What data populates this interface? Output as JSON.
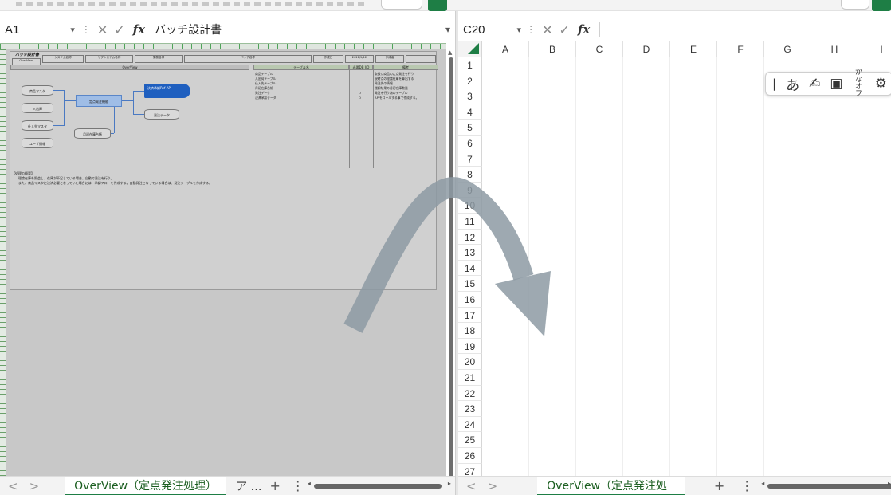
{
  "left": {
    "namebox": "A1",
    "formula_value": "バッチ設計書",
    "fx": "fx",
    "sheet": {
      "title": "バッチ設計書",
      "header_cells": [
        "システム名称",
        "サブシステム名称",
        "業務名称",
        "バッチ名称",
        "作成日",
        "2021/5/12",
        "作成者",
        "",
        "更新日",
        "2021/5/12",
        "更新者",
        ""
      ],
      "header_sub": [
        "OverView",
        "",
        "在庫管理",
        "商品在庫管理",
        "定点発注処理"
      ],
      "band_label": "OverView",
      "table_header": [
        "テーブル名",
        "必要DB I/O",
        "備考"
      ],
      "table_rows": [
        [
          "商品テーブル",
          "I",
          "取扱い商品の定点発注を行う"
        ],
        [
          "入出荷テーブル",
          "I",
          "現時点の理論在庫を算出する"
        ],
        [
          "仕入先テーブル",
          "I",
          "発注先の情報"
        ],
        [
          "月初在庫台帳",
          "I",
          "棚卸結果の月初在庫数量"
        ],
        [
          "発注データ",
          "O",
          "発注を行う為のテーブル"
        ],
        [
          "決済承認データ",
          "O",
          "APIをコールする事で作成する。"
        ]
      ],
      "flow": {
        "db1": "商品マスタ",
        "db2": "入出庫",
        "db3": "仕入先マスタ",
        "db4": "ユーザ情報",
        "proc": "定点発注機能",
        "api": "決済承認Ref API",
        "out1": "発注データ",
        "out2": "月初在庫台帳"
      },
      "notes": [
        "【処理の概要】",
        "理論在庫を照会し、在庫が不足している場合、自動で発注を行う。",
        "また、商品マスタに決済必要となっていた場合には、承認フローを作成する。自動発注となっている場合は、発注テーブルを作成する。"
      ]
    },
    "tab": "OverView（定点発注処理）",
    "tab_more": "ア …",
    "tab_add": "+",
    "tab_menu": "⋮"
  },
  "right": {
    "namebox": "C20",
    "formula_value": "",
    "fx": "fx",
    "columns": [
      "A",
      "B",
      "C",
      "D",
      "E",
      "F",
      "G",
      "H",
      "I"
    ],
    "rows": [
      "1",
      "2",
      "3",
      "4",
      "5",
      "6",
      "7",
      "8",
      "9",
      "10",
      "11",
      "12",
      "13",
      "14",
      "15",
      "16",
      "17",
      "18",
      "19",
      "20",
      "21",
      "22",
      "23",
      "24",
      "25",
      "26",
      "27"
    ],
    "tab": "OverView（定点発注処理）",
    "tab_add": "+",
    "tab_menu": "⋮",
    "ime": {
      "cursor": "|",
      "hiragana": "あ",
      "kana_top": "かな",
      "kana_bottom": "オフ"
    }
  },
  "nav": {
    "prev": "<",
    "next": ">"
  },
  "colors": {
    "accent": "#1e7e45",
    "arrow": "#8d9aa3",
    "api_blue": "#1f5fbf"
  }
}
